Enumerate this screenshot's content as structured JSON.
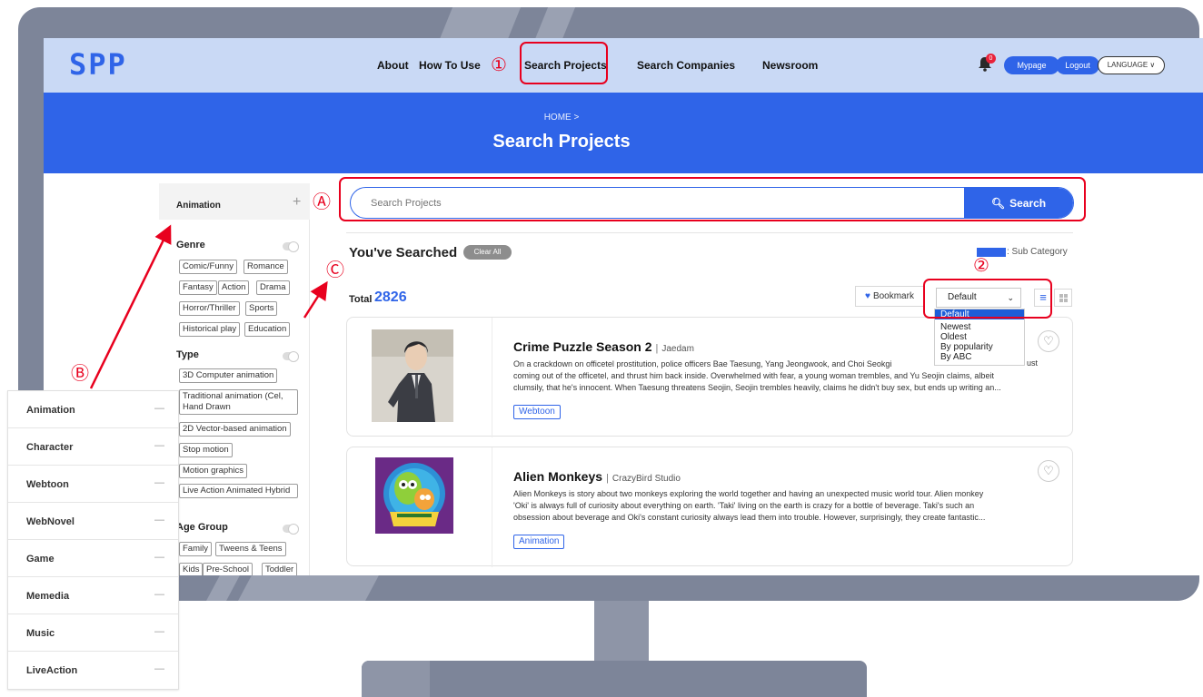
{
  "header": {
    "logo": "SPP",
    "nav": {
      "about": "About",
      "how_to_use": "How To Use",
      "search_projects": "Search Projects",
      "search_companies": "Search Companies",
      "newsroom": "Newsroom"
    },
    "notification_count": "0",
    "mypage": "Mypage",
    "logout": "Logout",
    "language": "LANGUAGE ∨"
  },
  "hero": {
    "breadcrumb": "HOME >",
    "title": "Search Projects"
  },
  "sidebar": {
    "top_label": "Animation",
    "top_plus": "+",
    "genre": {
      "title": "Genre",
      "chips": [
        "Comic/Funny",
        "Romance",
        "Fantasy",
        "Action",
        "Drama",
        "Horror/Thriller",
        "Sports",
        "Historical play",
        "Education"
      ]
    },
    "type": {
      "title": "Type",
      "chips": [
        "3D Computer animation",
        "Traditional animation (Cel, Hand Drawn",
        "2D Vector-based animation",
        "Stop motion",
        "Motion graphics",
        "Live Action Animated Hybrid"
      ]
    },
    "age_group": {
      "title": "Age Group",
      "chips": [
        "Family",
        "Tweens & Teens",
        "Kids",
        "Pre-School",
        "Toddler"
      ]
    }
  },
  "search": {
    "placeholder": "Search Projects",
    "button": "Search"
  },
  "results": {
    "searched_title": "You've Searched",
    "clear_all": "Clear All",
    "sub_category_label": ": Sub Category",
    "total_label": "Total",
    "total_value": "2826",
    "bookmark": "Bookmark",
    "sort": {
      "selected": "Default",
      "options": [
        "Default",
        "Newest",
        "Oldest",
        "By popularity",
        "By ABC"
      ]
    },
    "items": [
      {
        "title": "Crime Puzzle Season 2",
        "separator": "|",
        "company": "Jaedam",
        "desc_lines": [
          "On a crackdown on officetel prostitution, police officers Bae Taesung, Yang Jeongwook, and Choi Seokgi",
          "coming out of the officetel, and thrust him back inside. Overwhelmed with fear, a young woman trembles, and Yu Seojin claims, albeit",
          "clumsily, that he's innocent. When Taesung threatens Seojin, Seojin trembles heavily, claims he didn't buy sex, but ends up writing an..."
        ],
        "desc_overflow": "ust",
        "tag": "Webtoon"
      },
      {
        "title": "Alien Monkeys",
        "separator": "|",
        "company": "CrazyBird Studio",
        "desc_lines": [
          "Alien Monkeys is story about two monkeys exploring the world together and having an unexpected music world tour. Alien monkey",
          "'Oki' is always full of curiosity about everything on earth. 'Taki' living on the earth is crazy for a bottle of beverage. Taki's such an",
          "obsession about beverage and Oki's constant curiosity always lead them into trouble. However, surprisingly, they create fantastic..."
        ],
        "tag": "Animation"
      }
    ]
  },
  "annotations": {
    "n1": "①",
    "n2": "②",
    "A": "Ⓐ",
    "B": "Ⓑ",
    "C": "Ⓒ"
  },
  "category_panel": {
    "items": [
      "Animation",
      "Character",
      "Webtoon",
      "WebNovel",
      "Game",
      "Memedia",
      "Music",
      "LiveAction"
    ],
    "dash": "—"
  },
  "colors": {
    "brand_blue": "#2f64e8",
    "header_bg": "#c9d9f5",
    "annotation_red": "#e8001e",
    "monitor_gray": "#7d8599"
  }
}
